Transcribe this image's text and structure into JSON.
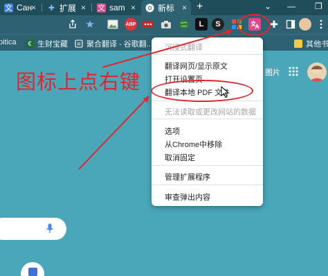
{
  "tabs": [
    {
      "title": "Сан",
      "favicon": "translate-icon",
      "close": "×"
    },
    {
      "title": "扩展",
      "favicon": "puzzle-icon",
      "close": "×"
    },
    {
      "title": "sam",
      "favicon": "extension-icon",
      "close": "×"
    },
    {
      "title": "新标",
      "favicon": "chrome-icon",
      "close": "×",
      "active": true
    }
  ],
  "new_tab": "+",
  "window_controls": {
    "dropdown": "⌄",
    "minimize": "—",
    "restore": "❐"
  },
  "toolbar": {
    "abp_label": "ABP",
    "extension_labels": {
      "e4": "L",
      "e5": "S"
    }
  },
  "bookmarks": [
    {
      "label": "pitica",
      "icon": "pitica-icon"
    },
    {
      "label": "生财宝藏",
      "icon": "sheng-cai-icon"
    },
    {
      "label": "聚合翻译 - 谷歌翻...",
      "icon": "translate-bookmark-icon"
    },
    {
      "label": "其他书签",
      "icon": "folder-icon"
    }
  ],
  "page": {
    "annotation": "图标上点右键",
    "topright_text": "图片"
  },
  "context_menu": {
    "header": "沉浸式翻译",
    "items": [
      {
        "label": "翻译网页/显示原文",
        "disabled": false
      },
      {
        "label": "打开设置页",
        "disabled": false
      },
      {
        "label": "翻译本地 PDF 文件",
        "disabled": false,
        "highlighted": true
      },
      {
        "label": "无法读取或更改网站的数据",
        "disabled": true
      },
      {
        "label": "选项",
        "disabled": false
      },
      {
        "label": "从Chrome中移除",
        "disabled": false
      },
      {
        "label": "取消固定",
        "disabled": false
      },
      {
        "label": "管理扩展程序",
        "disabled": false
      },
      {
        "label": "审查弹出内容",
        "disabled": false
      }
    ]
  },
  "colors": {
    "annotation_red": "#e0262d",
    "page_bg": "#4aa7b9",
    "toolbar_bg": "#2e6272",
    "tabstrip_bg": "#1f4e5a",
    "extension_pink": "#e0488b"
  }
}
